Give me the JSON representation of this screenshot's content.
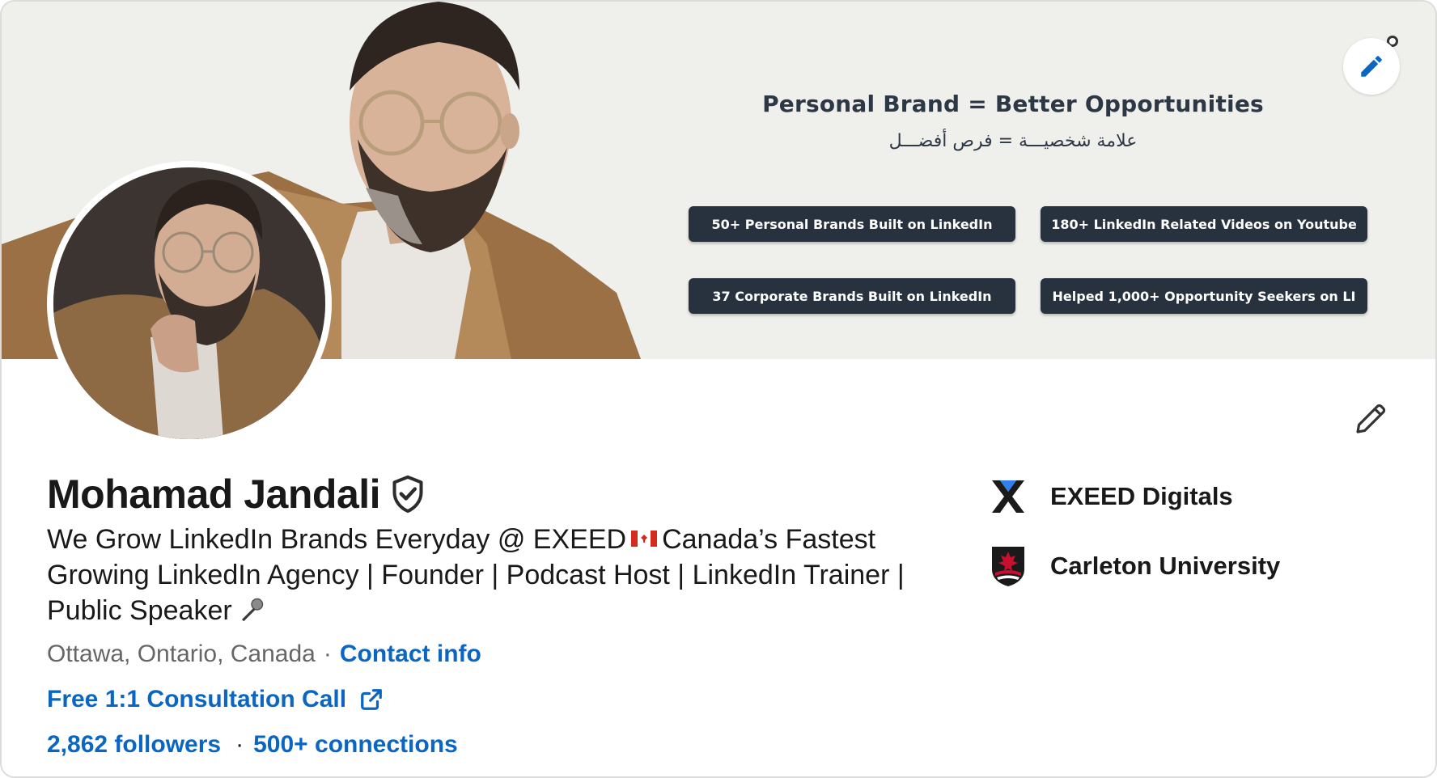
{
  "banner": {
    "title": "Personal Brand = Better Opportunities",
    "subtitle": "علامة شخصيـــة = فرص أفضـــل",
    "stats": [
      "50+ Personal Brands Built on LinkedIn",
      "180+ LinkedIn Related Videos on Youtube",
      "37 Corporate Brands Built on LinkedIn",
      "Helped 1,000+ Opportunity Seekers on LI"
    ]
  },
  "profile": {
    "name": "Mohamad Jandali",
    "headline_part1": "We Grow LinkedIn Brands Everyday @ EXEED",
    "headline_part2": "Canada’s Fastest Growing LinkedIn Agency | Founder | Podcast Host | LinkedIn Trainer | Public Speaker",
    "location": "Ottawa, Ontario, Canada",
    "contact_info": "Contact info",
    "website_link": "Free 1:1 Consultation Call",
    "followers": "2,862 followers",
    "connections": "500+ connections",
    "separator": "·"
  },
  "organizations": [
    {
      "name": "EXEED Digitals",
      "icon": "exeed-logo"
    },
    {
      "name": "Carleton University",
      "icon": "carleton-logo"
    }
  ],
  "colors": {
    "link": "#0a66c2",
    "pill_bg": "#28323f",
    "banner_bg": "#efefeb"
  }
}
